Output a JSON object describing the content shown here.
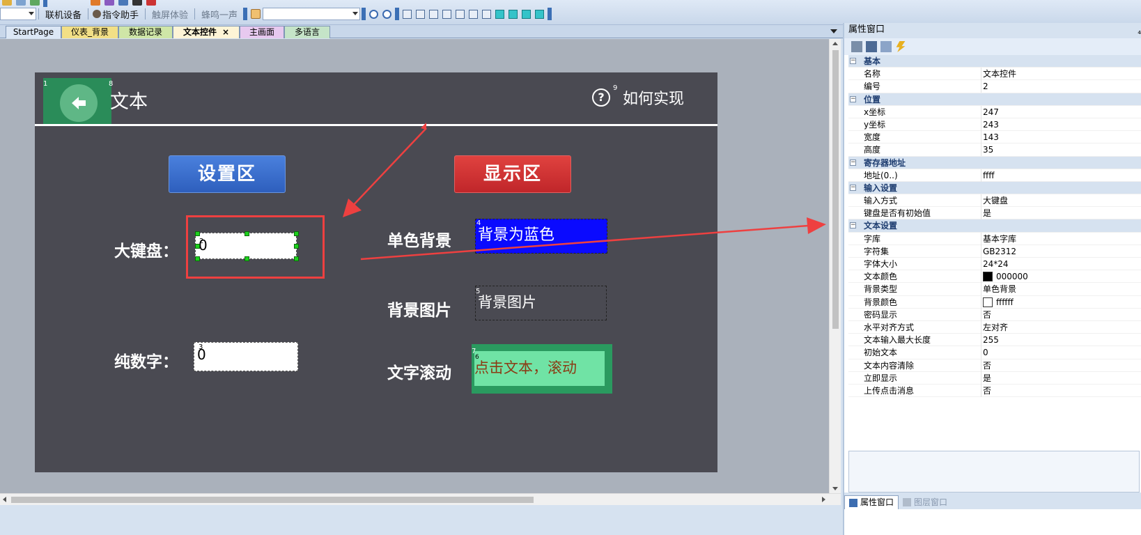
{
  "toolbar": {
    "items": [
      "联机设备",
      "指令助手",
      "触屏体验",
      "蜂鸣一声"
    ]
  },
  "tabs": [
    {
      "label": "StartPage",
      "color": "#dce7f5"
    },
    {
      "label": "仪表_背景",
      "color": "#f2df86"
    },
    {
      "label": "数据记录",
      "color": "#cfe6a7"
    },
    {
      "label": "文本控件",
      "color": "#fdf4d6",
      "active": true,
      "close": "×"
    },
    {
      "label": "主画面",
      "color": "#e7c9ef"
    },
    {
      "label": "多语言",
      "color": "#c5e4c8"
    }
  ],
  "hmi": {
    "title": "文本",
    "help_icon": "?",
    "help_text": "如何实现",
    "btn_setup": "设置区",
    "btn_show": "显示区",
    "label_big_keyboard": "大键盘：",
    "label_numeric": "纯数字：",
    "label_solid_bg": "单色背景",
    "label_bg_image": "背景图片",
    "label_scroll": "文字滚动",
    "field_big_keyboard_value": "0",
    "field_numeric_value": "0",
    "solid_bg_text": "背景为蓝色",
    "bg_image_text": "背景图片",
    "scroll_text": "点击文本，滚动",
    "indices": {
      "back": "1",
      "title": "8",
      "help": "9",
      "big_kb": "2",
      "numeric": "3",
      "solid": "4",
      "image": "5",
      "scroll": "7",
      "scroll_inner": "6"
    }
  },
  "panel": {
    "title": "属性窗口",
    "pin": "₄",
    "groups": [
      {
        "name": "基本",
        "rows": [
          [
            "名称",
            "文本控件"
          ],
          [
            "编号",
            "2"
          ]
        ]
      },
      {
        "name": "位置",
        "rows": [
          [
            "x坐标",
            "247"
          ],
          [
            "y坐标",
            "243"
          ],
          [
            "宽度",
            "143"
          ],
          [
            "高度",
            "35"
          ]
        ]
      },
      {
        "name": "寄存器地址",
        "rows": [
          [
            "地址(0..)",
            "ffff"
          ]
        ]
      },
      {
        "name": "输入设置",
        "rows": [
          [
            "输入方式",
            "大键盘"
          ],
          [
            "键盘是否有初始值",
            "是"
          ]
        ]
      },
      {
        "name": "文本设置",
        "rows": [
          [
            "字库",
            "基本字库"
          ],
          [
            "字符集",
            "GB2312"
          ],
          [
            "字体大小",
            "24*24"
          ],
          [
            "文本颜色",
            "000000"
          ],
          [
            "背景类型",
            "单色背景"
          ],
          [
            "背景颜色",
            "ffffff"
          ],
          [
            "密码显示",
            "否"
          ],
          [
            "水平对齐方式",
            "左对齐"
          ],
          [
            "文本输入最大长度",
            "255"
          ],
          [
            "初始文本",
            "0"
          ],
          [
            "文本内容清除",
            "否"
          ],
          [
            "立即显示",
            "是"
          ],
          [
            "上传点击消息",
            "否"
          ]
        ]
      }
    ],
    "colors": {
      "text_color": "#000000",
      "bg_color": "#ffffff"
    },
    "bottom_tabs": [
      "属性窗口",
      "图层窗口"
    ]
  }
}
